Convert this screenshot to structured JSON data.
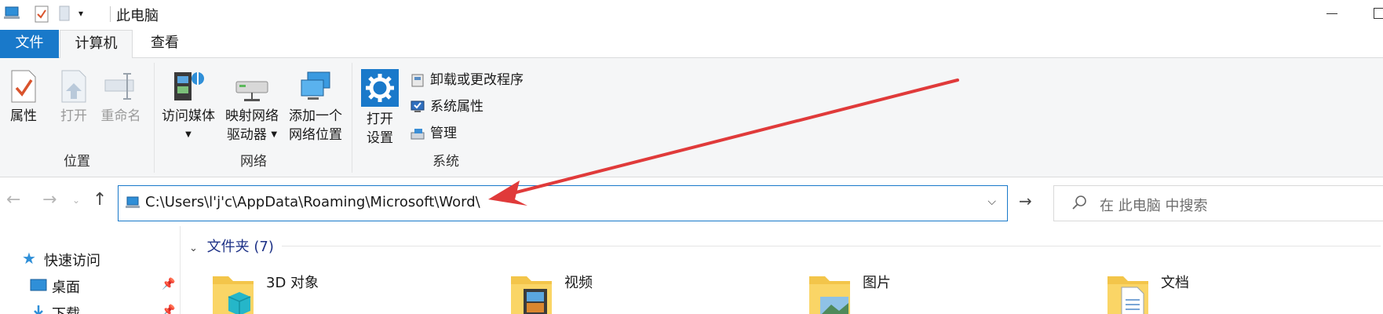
{
  "window": {
    "title": "此电脑"
  },
  "ribbon_tabs": {
    "file": "文件",
    "computer": "计算机",
    "view": "查看"
  },
  "ribbon": {
    "location_group": {
      "label": "位置",
      "properties": "属性",
      "open": "打开",
      "rename": "重命名"
    },
    "network_group": {
      "label": "网络",
      "access_media": "访问媒体",
      "map_drive_line1": "映射网络",
      "map_drive_line2": "驱动器",
      "add_location_line1": "添加一个",
      "add_location_line2": "网络位置"
    },
    "system_group": {
      "label": "系统",
      "open_settings_line1": "打开",
      "open_settings_line2": "设置",
      "uninstall": "卸载或更改程序",
      "system_properties": "系统属性",
      "manage": "管理"
    }
  },
  "address_bar": {
    "path": "C:\\Users\\l'j'c\\AppData\\Roaming\\Microsoft\\Word\\"
  },
  "search": {
    "placeholder": "在 此电脑 中搜索"
  },
  "nav_pane": {
    "quick_access": "快速访问",
    "desktop": "桌面",
    "downloads": "下载"
  },
  "content": {
    "section_header": "文件夹 (7)",
    "folders": [
      "3D 对象",
      "视频",
      "图片",
      "文档"
    ]
  },
  "colors": {
    "accent": "#1979ca",
    "annotation_arrow": "#e03a3a"
  },
  "icons": {
    "back": "arrow-left-icon",
    "forward": "arrow-right-icon",
    "up": "arrow-up-icon",
    "search": "magnifier-icon"
  }
}
